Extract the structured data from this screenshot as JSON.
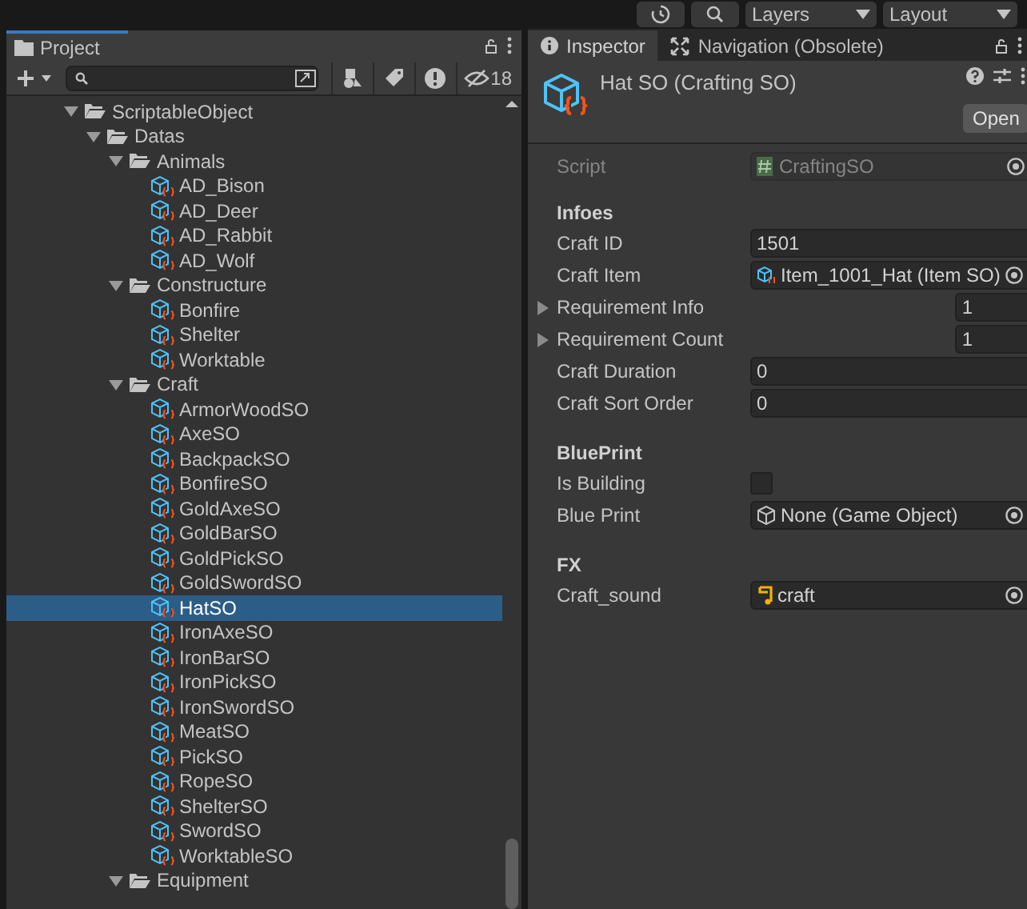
{
  "toolbar": {
    "layers": "Layers",
    "layout": "Layout"
  },
  "project": {
    "tab": "Project",
    "hidden_count": "18",
    "tree": [
      {
        "label": "ScriptableObject",
        "kind": "folder",
        "expanded": true,
        "selected": false,
        "children": [
          {
            "label": "Datas",
            "kind": "folder",
            "expanded": true,
            "selected": false,
            "children": [
              {
                "label": "Animals",
                "kind": "folder",
                "expanded": true,
                "selected": false,
                "children": [
                  {
                    "label": "AD_Bison",
                    "kind": "asset",
                    "selected": false
                  },
                  {
                    "label": "AD_Deer",
                    "kind": "asset",
                    "selected": false
                  },
                  {
                    "label": "AD_Rabbit",
                    "kind": "asset",
                    "selected": false
                  },
                  {
                    "label": "AD_Wolf",
                    "kind": "asset",
                    "selected": false
                  }
                ]
              },
              {
                "label": "Constructure",
                "kind": "folder",
                "expanded": true,
                "selected": false,
                "children": [
                  {
                    "label": "Bonfire",
                    "kind": "asset",
                    "selected": false
                  },
                  {
                    "label": "Shelter",
                    "kind": "asset",
                    "selected": false
                  },
                  {
                    "label": "Worktable",
                    "kind": "asset",
                    "selected": false
                  }
                ]
              },
              {
                "label": "Craft",
                "kind": "folder",
                "expanded": true,
                "selected": false,
                "children": [
                  {
                    "label": "ArmorWoodSO",
                    "kind": "asset",
                    "selected": false
                  },
                  {
                    "label": "AxeSO",
                    "kind": "asset",
                    "selected": false
                  },
                  {
                    "label": "BackpackSO",
                    "kind": "asset",
                    "selected": false
                  },
                  {
                    "label": "BonfireSO",
                    "kind": "asset",
                    "selected": false
                  },
                  {
                    "label": "GoldAxeSO",
                    "kind": "asset",
                    "selected": false
                  },
                  {
                    "label": "GoldBarSO",
                    "kind": "asset",
                    "selected": false
                  },
                  {
                    "label": "GoldPickSO",
                    "kind": "asset",
                    "selected": false
                  },
                  {
                    "label": "GoldSwordSO",
                    "kind": "asset",
                    "selected": false
                  },
                  {
                    "label": "HatSO",
                    "kind": "asset",
                    "selected": true
                  },
                  {
                    "label": "IronAxeSO",
                    "kind": "asset",
                    "selected": false
                  },
                  {
                    "label": "IronBarSO",
                    "kind": "asset",
                    "selected": false
                  },
                  {
                    "label": "IronPickSO",
                    "kind": "asset",
                    "selected": false
                  },
                  {
                    "label": "IronSwordSO",
                    "kind": "asset",
                    "selected": false
                  },
                  {
                    "label": "MeatSO",
                    "kind": "asset",
                    "selected": false
                  },
                  {
                    "label": "PickSO",
                    "kind": "asset",
                    "selected": false
                  },
                  {
                    "label": "RopeSO",
                    "kind": "asset",
                    "selected": false
                  },
                  {
                    "label": "ShelterSO",
                    "kind": "asset",
                    "selected": false
                  },
                  {
                    "label": "SwordSO",
                    "kind": "asset",
                    "selected": false
                  },
                  {
                    "label": "WorktableSO",
                    "kind": "asset",
                    "selected": false
                  }
                ]
              },
              {
                "label": "Equipment",
                "kind": "folder",
                "expanded": true,
                "selected": false
              }
            ]
          }
        ]
      }
    ]
  },
  "inspector": {
    "tabs": [
      {
        "label": "Inspector",
        "selected": true
      },
      {
        "label": "Navigation (Obsolete)",
        "selected": false
      }
    ],
    "title": "Hat SO (Crafting SO)",
    "open_button": "Open",
    "properties": [
      {
        "kind": "script",
        "label": "Script",
        "value": "CraftingSO",
        "disabled": true
      },
      {
        "kind": "header",
        "label": "Infoes"
      },
      {
        "kind": "text",
        "label": "Craft ID",
        "value": "1501"
      },
      {
        "kind": "object",
        "label": "Craft Item",
        "value": "Item_1001_Hat (Item SO)"
      },
      {
        "kind": "foldout",
        "label": "Requirement Info",
        "value": "1"
      },
      {
        "kind": "foldout",
        "label": "Requirement Count",
        "value": "1"
      },
      {
        "kind": "text",
        "label": "Craft Duration",
        "value": "0"
      },
      {
        "kind": "text",
        "label": "Craft Sort Order",
        "value": "0"
      },
      {
        "kind": "header",
        "label": "BluePrint"
      },
      {
        "kind": "checkbox",
        "label": "Is Building",
        "checked": false
      },
      {
        "kind": "object",
        "label": "Blue Print",
        "value": "None (Game Object)"
      },
      {
        "kind": "header",
        "label": "FX"
      },
      {
        "kind": "object",
        "label": "Craft_sound",
        "value": "craft"
      }
    ]
  }
}
